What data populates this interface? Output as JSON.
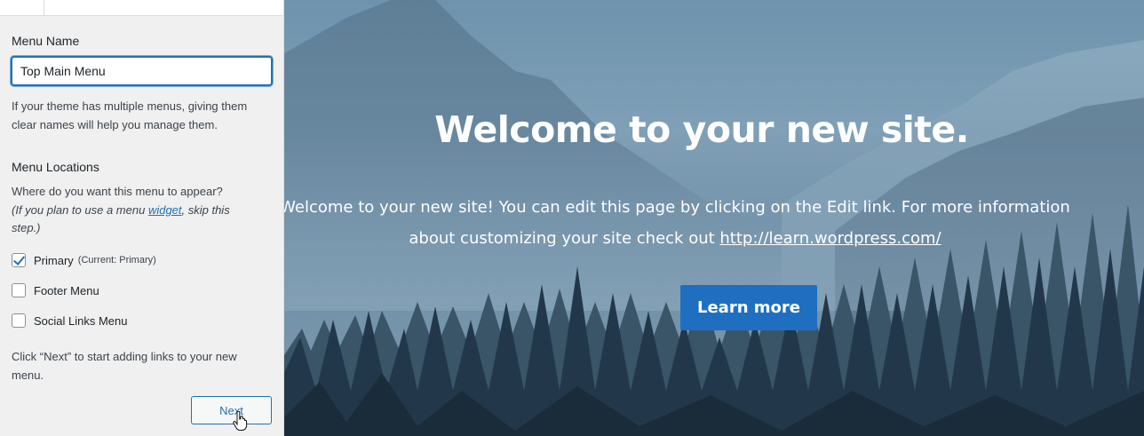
{
  "panel": {
    "menu_name_label": "Menu Name",
    "menu_name_value": "Top Main Menu",
    "menu_name_help": "If your theme has multiple menus, giving them clear names will help you manage them.",
    "locations_label": "Menu Locations",
    "locations_question": "Where do you want this menu to appear?",
    "locations_hint_prefix": "(If you plan to use a menu ",
    "locations_hint_link": "widget",
    "locations_hint_suffix": ", skip this step.)",
    "locations": [
      {
        "label": "Primary",
        "note": "(Current: Primary)",
        "checked": true
      },
      {
        "label": "Footer Menu",
        "note": "",
        "checked": false
      },
      {
        "label": "Social Links Menu",
        "note": "",
        "checked": false
      }
    ],
    "next_help": "Click “Next” to start adding links to your new menu.",
    "next_label": "Next"
  },
  "preview": {
    "title": "Welcome to your new site.",
    "body_line1": "Welcome to your new site! You can edit this page by clicking on the Edit link. For more information",
    "body_line2_prefix": "about customizing your site check out ",
    "body_link": "http://learn.wordpress.com/",
    "button_label": "Learn more"
  },
  "colors": {
    "accent": "#2271b1",
    "hero_button": "#1f6fc1"
  }
}
